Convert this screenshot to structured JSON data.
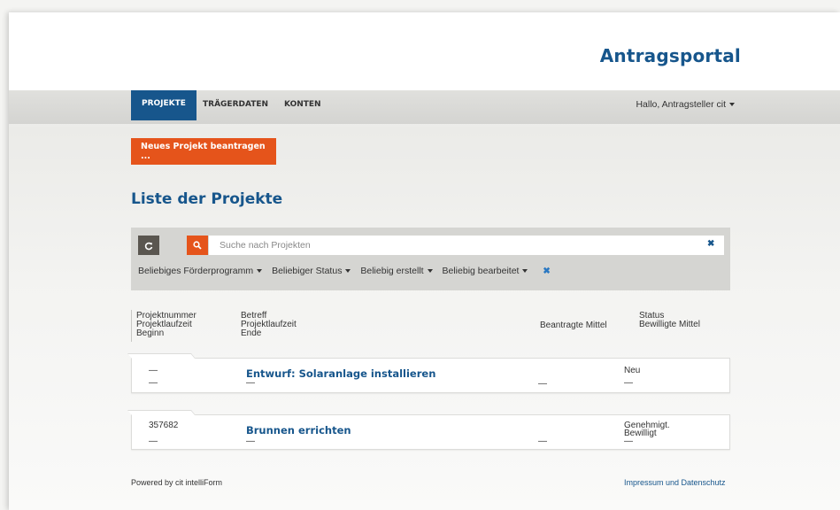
{
  "header": {
    "brand": "Antragsportal"
  },
  "nav": {
    "tabs": [
      {
        "label": "PROJEKTE",
        "active": true
      },
      {
        "label": "TRÄGERDATEN",
        "active": false
      },
      {
        "label": "KONTEN",
        "active": false
      }
    ],
    "user_menu": "Hallo, Antragsteller cit"
  },
  "actions": {
    "new_project": "Neues Projekt beantragen ..."
  },
  "list": {
    "title": "Liste der Projekte",
    "search_placeholder": "Suche nach Projekten",
    "search_value": "",
    "filters": [
      "Beliebiges Förderprogramm",
      "Beliebiger Status",
      "Beliebig erstellt",
      "Beliebig bearbeitet"
    ],
    "columns": {
      "col1": [
        "Projektnummer",
        "Projektlaufzeit",
        "Beginn"
      ],
      "col2": [
        "Betreff",
        "Projektlaufzeit",
        "Ende"
      ],
      "col3": "Beantragte Mittel",
      "col4": [
        "Status",
        "Bewilligte Mittel"
      ]
    },
    "rows": [
      {
        "number": "—",
        "begin": "—",
        "subject": "Entwurf: Solaranlage installieren",
        "end": "—",
        "requested": "—",
        "status": "Neu",
        "status2": "",
        "approved": "—"
      },
      {
        "number": "357682",
        "begin": "—",
        "subject": "Brunnen errichten",
        "end": "—",
        "requested": "—",
        "status": "Genehmigt.",
        "status2": "Bewilligt",
        "approved": "—"
      }
    ]
  },
  "footer": {
    "powered": "Powered by cit intelliForm",
    "legal": "Impressum und Datenschutz"
  },
  "colors": {
    "brand_blue": "#17568c",
    "accent_orange": "#e5541b",
    "panel_gray": "#d5d5d2"
  },
  "icons": {
    "refresh": "refresh-icon",
    "search": "search-icon",
    "clear": "close-icon"
  }
}
